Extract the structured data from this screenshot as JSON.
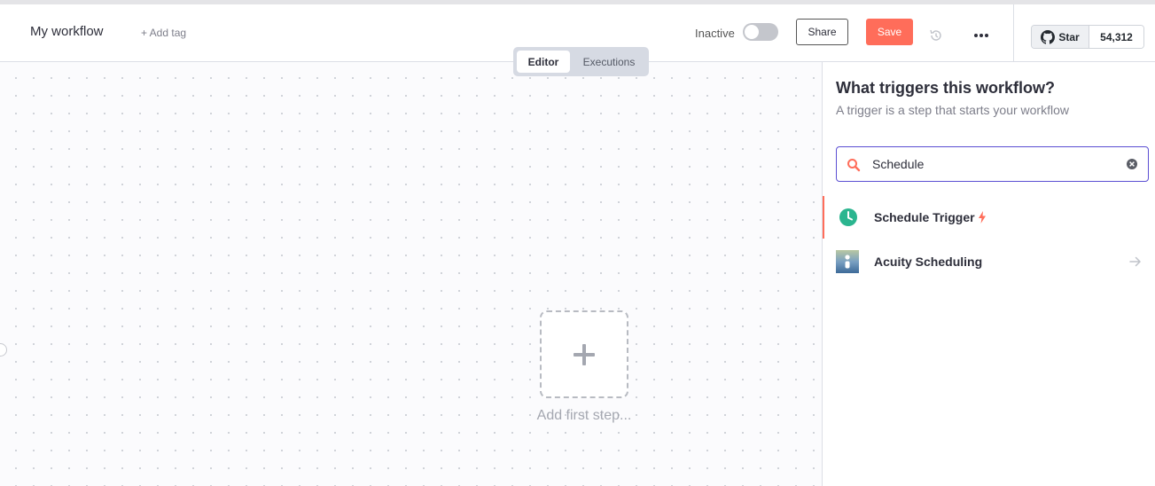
{
  "header": {
    "workflow_name": "My workflow",
    "add_tag": "+ Add tag",
    "active_label": "Inactive",
    "active": false,
    "share_label": "Share",
    "save_label": "Save",
    "github_star_label": "Star",
    "github_star_count": "54,312"
  },
  "tabs": [
    {
      "label": "Editor",
      "active": true
    },
    {
      "label": "Executions",
      "active": false
    }
  ],
  "canvas": {
    "add_first_step": "Add first step..."
  },
  "panel": {
    "title": "What triggers this workflow?",
    "subtitle": "A trigger is a step that starts your workflow",
    "search_value": "Schedule",
    "results": [
      {
        "label": "Schedule Trigger",
        "icon": "clock-icon",
        "badge": "bolt-icon",
        "selected": true
      },
      {
        "label": "Acuity Scheduling",
        "icon": "acuity-logo-icon",
        "trailing": "arrow-right-icon",
        "selected": false
      }
    ]
  },
  "colors": {
    "accent": "#ff6d5a",
    "focus": "#5b4fd3",
    "schedule_green": "#2bb58f"
  }
}
